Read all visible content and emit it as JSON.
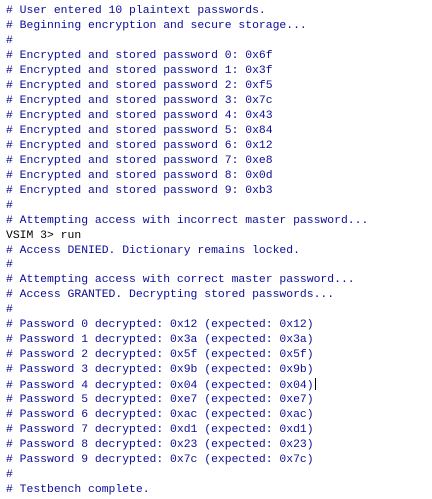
{
  "console": {
    "lines": [
      {
        "text": "# User entered 10 plaintext passwords.",
        "kind": "comment"
      },
      {
        "text": "# Beginning encryption and secure storage...",
        "kind": "comment"
      },
      {
        "text": "#",
        "kind": "comment"
      },
      {
        "text": "# Encrypted and stored password 0: 0x6f",
        "kind": "comment"
      },
      {
        "text": "# Encrypted and stored password 1: 0x3f",
        "kind": "comment"
      },
      {
        "text": "# Encrypted and stored password 2: 0xf5",
        "kind": "comment"
      },
      {
        "text": "# Encrypted and stored password 3: 0x7c",
        "kind": "comment"
      },
      {
        "text": "# Encrypted and stored password 4: 0x43",
        "kind": "comment"
      },
      {
        "text": "# Encrypted and stored password 5: 0x84",
        "kind": "comment"
      },
      {
        "text": "# Encrypted and stored password 6: 0x12",
        "kind": "comment"
      },
      {
        "text": "# Encrypted and stored password 7: 0xe8",
        "kind": "comment"
      },
      {
        "text": "# Encrypted and stored password 8: 0x0d",
        "kind": "comment"
      },
      {
        "text": "# Encrypted and stored password 9: 0xb3",
        "kind": "comment"
      },
      {
        "text": "#",
        "kind": "comment"
      },
      {
        "text": "# Attempting access with incorrect master password...",
        "kind": "comment"
      },
      {
        "text": "VSIM 3> run",
        "kind": "prompt"
      },
      {
        "text": "# Access DENIED. Dictionary remains locked.",
        "kind": "comment"
      },
      {
        "text": "#",
        "kind": "comment"
      },
      {
        "text": "# Attempting access with correct master password...",
        "kind": "comment"
      },
      {
        "text": "# Access GRANTED. Decrypting stored passwords...",
        "kind": "comment"
      },
      {
        "text": "#",
        "kind": "comment"
      },
      {
        "text": "# Password 0 decrypted: 0x12 (expected: 0x12)",
        "kind": "comment"
      },
      {
        "text": "# Password 1 decrypted: 0x3a (expected: 0x3a)",
        "kind": "comment"
      },
      {
        "text": "# Password 2 decrypted: 0x5f (expected: 0x5f)",
        "kind": "comment"
      },
      {
        "text": "# Password 3 decrypted: 0x9b (expected: 0x9b)",
        "kind": "comment"
      },
      {
        "text": "# Password 4 decrypted: 0x04 (expected: 0x04)",
        "kind": "comment",
        "cursor": true
      },
      {
        "text": "# Password 5 decrypted: 0xe7 (expected: 0xe7)",
        "kind": "comment"
      },
      {
        "text": "# Password 6 decrypted: 0xac (expected: 0xac)",
        "kind": "comment"
      },
      {
        "text": "# Password 7 decrypted: 0xd1 (expected: 0xd1)",
        "kind": "comment"
      },
      {
        "text": "# Password 8 decrypted: 0x23 (expected: 0x23)",
        "kind": "comment"
      },
      {
        "text": "# Password 9 decrypted: 0x7c (expected: 0x7c)",
        "kind": "comment"
      },
      {
        "text": "#",
        "kind": "comment"
      },
      {
        "text": "# Testbench complete.",
        "kind": "comment"
      },
      {
        "text": "#",
        "kind": "grey"
      }
    ]
  }
}
